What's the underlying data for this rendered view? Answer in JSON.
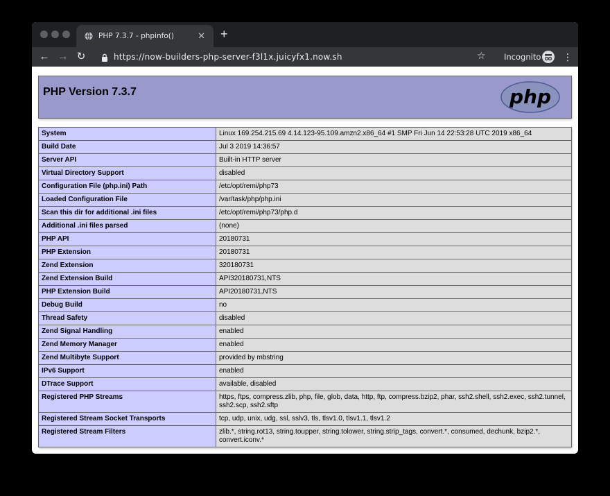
{
  "browser": {
    "tab_title": "PHP 7.3.7 - phpinfo()",
    "url": "https://now-builders-php-server-f3l1x.juicyfx1.now.sh",
    "incognito_label": "Incognito",
    "icons": [
      "back-icon",
      "forward-icon",
      "reload-icon",
      "lock-icon",
      "star-icon",
      "incognito-icon",
      "menu-icon",
      "globe-icon",
      "close-icon",
      "plus-icon"
    ]
  },
  "php": {
    "header_title": "PHP Version 7.3.7",
    "logo_text": "php",
    "colors": {
      "header_bg": "#9999cc",
      "key_bg": "#ccccff",
      "value_bg": "#dddddd"
    },
    "rows": [
      {
        "key": "System",
        "value": "Linux 169.254.215.69 4.14.123-95.109.amzn2.x86_64 #1 SMP Fri Jun 14 22:53:28 UTC 2019 x86_64"
      },
      {
        "key": "Build Date",
        "value": "Jul 3 2019 14:36:57"
      },
      {
        "key": "Server API",
        "value": "Built-in HTTP server"
      },
      {
        "key": "Virtual Directory Support",
        "value": "disabled"
      },
      {
        "key": "Configuration File (php.ini) Path",
        "value": "/etc/opt/remi/php73"
      },
      {
        "key": "Loaded Configuration File",
        "value": "/var/task/php/php.ini"
      },
      {
        "key": "Scan this dir for additional .ini files",
        "value": "/etc/opt/remi/php73/php.d"
      },
      {
        "key": "Additional .ini files parsed",
        "value": "(none)"
      },
      {
        "key": "PHP API",
        "value": "20180731"
      },
      {
        "key": "PHP Extension",
        "value": "20180731"
      },
      {
        "key": "Zend Extension",
        "value": "320180731"
      },
      {
        "key": "Zend Extension Build",
        "value": "API320180731,NTS"
      },
      {
        "key": "PHP Extension Build",
        "value": "API20180731,NTS"
      },
      {
        "key": "Debug Build",
        "value": "no"
      },
      {
        "key": "Thread Safety",
        "value": "disabled"
      },
      {
        "key": "Zend Signal Handling",
        "value": "enabled"
      },
      {
        "key": "Zend Memory Manager",
        "value": "enabled"
      },
      {
        "key": "Zend Multibyte Support",
        "value": "provided by mbstring"
      },
      {
        "key": "IPv6 Support",
        "value": "enabled"
      },
      {
        "key": "DTrace Support",
        "value": "available, disabled"
      },
      {
        "key": "Registered PHP Streams",
        "value": "https, ftps, compress.zlib, php, file, glob, data, http, ftp, compress.bzip2, phar, ssh2.shell, ssh2.exec, ssh2.tunnel, ssh2.scp, ssh2.sftp"
      },
      {
        "key": "Registered Stream Socket Transports",
        "value": "tcp, udp, unix, udg, ssl, sslv3, tls, tlsv1.0, tlsv1.1, tlsv1.2"
      },
      {
        "key": "Registered Stream Filters",
        "value": "zlib.*, string.rot13, string.toupper, string.tolower, string.strip_tags, convert.*, consumed, dechunk, bzip2.*, convert.iconv.*"
      }
    ]
  }
}
